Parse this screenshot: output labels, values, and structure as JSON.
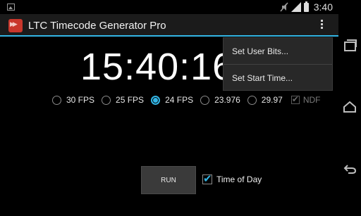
{
  "status_bar": {
    "time": "3:40",
    "icons": [
      "gallery-icon",
      "mute-icon",
      "signal-icon",
      "battery-icon"
    ]
  },
  "action_bar": {
    "title": "LTC Timecode Generator Pro",
    "app_icon": "app-icon",
    "overflow_icon": "overflow-menu-icon",
    "accent_color": "#33b5e5"
  },
  "timecode": {
    "display": "15:40:16:"
  },
  "fps_options": [
    {
      "label": "30 FPS",
      "selected": false
    },
    {
      "label": "25 FPS",
      "selected": false
    },
    {
      "label": "24 FPS",
      "selected": true
    },
    {
      "label": "23.976",
      "selected": false
    },
    {
      "label": "29.97",
      "selected": false
    }
  ],
  "ndf": {
    "label": "NDF",
    "checked": true,
    "enabled": false
  },
  "run_button": {
    "label": "RUN"
  },
  "time_of_day": {
    "label": "Time of Day",
    "checked": true
  },
  "overflow_menu": {
    "items": [
      "Set User Bits...",
      "Set Start Time..."
    ]
  },
  "nav_bar": {
    "buttons": [
      "recent-apps-icon",
      "home-icon",
      "back-icon"
    ]
  }
}
